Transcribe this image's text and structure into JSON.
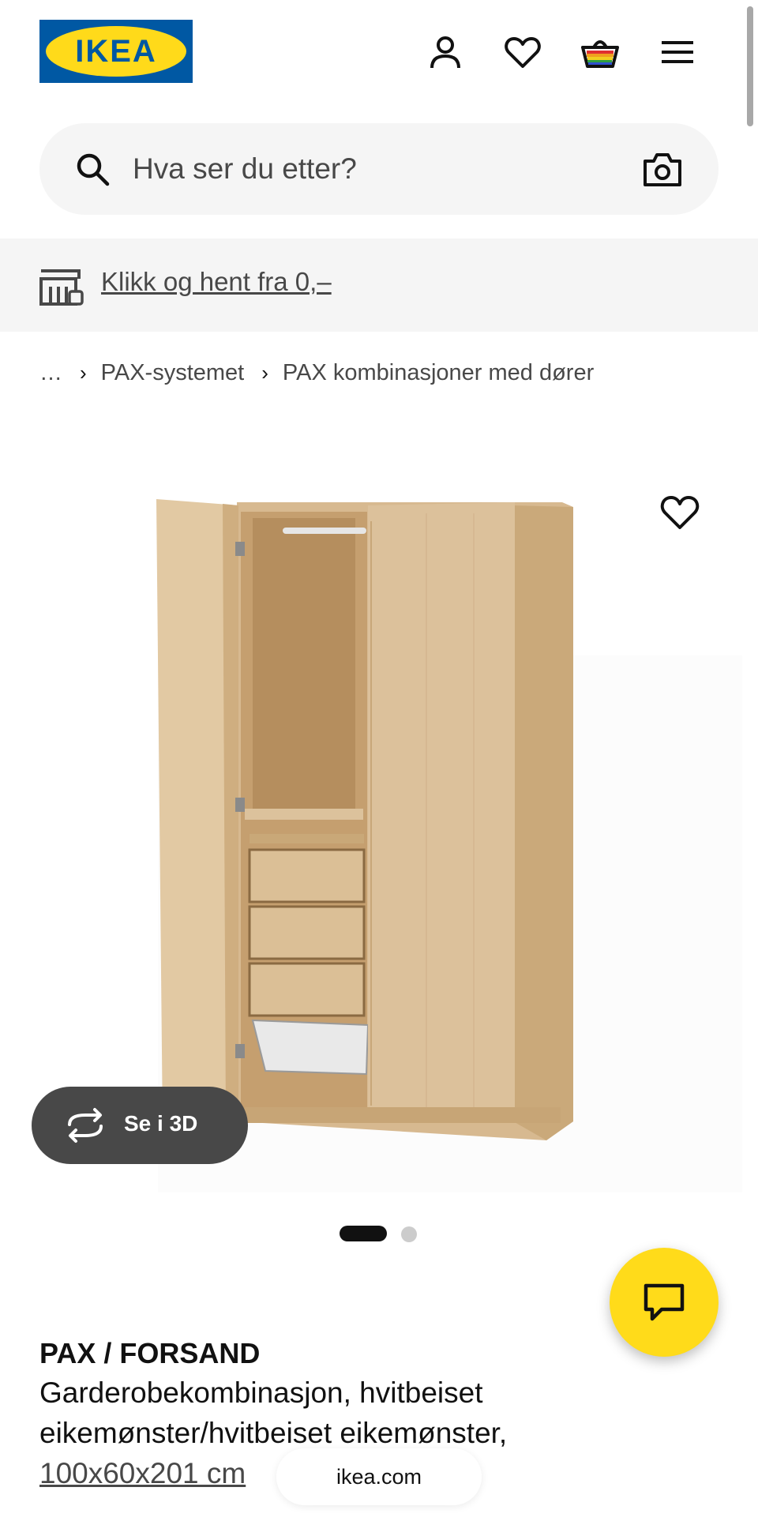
{
  "header": {
    "logo_text": "IKEA",
    "brand_colors": {
      "blue": "#0058a3",
      "yellow": "#ffda1a"
    },
    "icons": [
      "profile-icon",
      "favourites-heart-icon",
      "shopping-bag-icon",
      "hamburger-menu-icon"
    ]
  },
  "search": {
    "placeholder": "Hva ser du etter?",
    "icons": [
      "search-icon",
      "camera-search-icon"
    ]
  },
  "banner": {
    "link_text": "Klikk og hent fra 0,–",
    "icon": "store-pickup-icon"
  },
  "breadcrumb": {
    "ellipsis": "…",
    "items": [
      "PAX-systemet",
      "PAX kombinasjoner med dører"
    ]
  },
  "gallery": {
    "view_3d_label": "Se i 3D",
    "image_count": 2,
    "active_index": 0
  },
  "product": {
    "name": "PAX / FORSAND",
    "description_line1": "Garderobekombinasjon, hvitbeiset",
    "description_line2": "eikemønster/hvitbeiset eikemønster,",
    "size": "100x60x201 cm"
  },
  "chat": {
    "icon": "chat-bubble-icon",
    "color": "#ffdb1a"
  },
  "browser": {
    "domain": "ikea.com"
  }
}
